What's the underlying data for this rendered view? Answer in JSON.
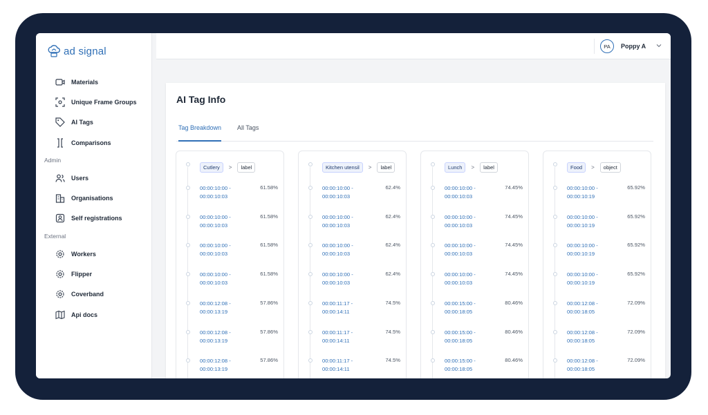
{
  "brand": {
    "name": "ad signal",
    "color": "#2f6fb6"
  },
  "sidebar": {
    "main_items": [
      {
        "label": "Materials",
        "icon": "video-icon"
      },
      {
        "label": "Unique Frame Groups",
        "icon": "frame-icon"
      },
      {
        "label": "AI Tags",
        "icon": "tag-icon"
      },
      {
        "label": "Comparisons",
        "icon": "compare-icon"
      }
    ],
    "admin_label": "Admin",
    "admin_items": [
      {
        "label": "Users",
        "icon": "users-icon"
      },
      {
        "label": "Organisations",
        "icon": "building-icon"
      },
      {
        "label": "Self registrations",
        "icon": "user-badge-icon"
      }
    ],
    "external_label": "External",
    "external_items": [
      {
        "label": "Workers",
        "icon": "gear-icon"
      },
      {
        "label": "Flipper",
        "icon": "gear-icon"
      },
      {
        "label": "Coverband",
        "icon": "gear-icon"
      },
      {
        "label": "Api docs",
        "icon": "map-icon"
      }
    ]
  },
  "topbar": {
    "avatar_initials": "PA",
    "user_name": "Poppy A"
  },
  "page": {
    "title": "AI Tag Info",
    "tabs": [
      {
        "label": "Tag Breakdown",
        "active": true
      },
      {
        "label": "All Tags",
        "active": false
      }
    ]
  },
  "columns": [
    {
      "tag": "Cutlery",
      "type": "label",
      "entries": [
        {
          "start": "00:00:10:00 -",
          "end": "00:00:10:03",
          "pct": "61.58%"
        },
        {
          "start": "00:00:10:00 -",
          "end": "00:00:10:03",
          "pct": "61.58%"
        },
        {
          "start": "00:00:10:00 -",
          "end": "00:00:10:03",
          "pct": "61.58%"
        },
        {
          "start": "00:00:10:00 -",
          "end": "00:00:10:03",
          "pct": "61.58%"
        },
        {
          "start": "00:00:12:08 -",
          "end": "00:00:13:19",
          "pct": "57.86%"
        },
        {
          "start": "00:00:12:08 -",
          "end": "00:00:13:19",
          "pct": "57.86%"
        },
        {
          "start": "00:00:12:08 -",
          "end": "00:00:13:19",
          "pct": "57.86%"
        }
      ]
    },
    {
      "tag": "Kitchen utensil",
      "type": "label",
      "entries": [
        {
          "start": "00:00:10:00 -",
          "end": "00:00:10:03",
          "pct": "62.4%"
        },
        {
          "start": "00:00:10:00 -",
          "end": "00:00:10:03",
          "pct": "62.4%"
        },
        {
          "start": "00:00:10:00 -",
          "end": "00:00:10:03",
          "pct": "62.4%"
        },
        {
          "start": "00:00:10:00 -",
          "end": "00:00:10:03",
          "pct": "62.4%"
        },
        {
          "start": "00:00:11:17 -",
          "end": "00:00:14:11",
          "pct": "74.5%"
        },
        {
          "start": "00:00:11:17 -",
          "end": "00:00:14:11",
          "pct": "74.5%"
        },
        {
          "start": "00:00:11:17 -",
          "end": "00:00:14:11",
          "pct": "74.5%"
        }
      ]
    },
    {
      "tag": "Lunch",
      "type": "label",
      "entries": [
        {
          "start": "00:00:10:00 -",
          "end": "00:00:10:03",
          "pct": "74.45%"
        },
        {
          "start": "00:00:10:00 -",
          "end": "00:00:10:03",
          "pct": "74.45%"
        },
        {
          "start": "00:00:10:00 -",
          "end": "00:00:10:03",
          "pct": "74.45%"
        },
        {
          "start": "00:00:10:00 -",
          "end": "00:00:10:03",
          "pct": "74.45%"
        },
        {
          "start": "00:00:15:00 -",
          "end": "00:00:18:05",
          "pct": "80.46%"
        },
        {
          "start": "00:00:15:00 -",
          "end": "00:00:18:05",
          "pct": "80.46%"
        },
        {
          "start": "00:00:15:00 -",
          "end": "00:00:18:05",
          "pct": "80.46%"
        }
      ]
    },
    {
      "tag": "Food",
      "type": "object",
      "entries": [
        {
          "start": "00:00:10:00 -",
          "end": "00:00:10:19",
          "pct": "65.92%"
        },
        {
          "start": "00:00:10:00 -",
          "end": "00:00:10:19",
          "pct": "65.92%"
        },
        {
          "start": "00:00:10:00 -",
          "end": "00:00:10:19",
          "pct": "65.92%"
        },
        {
          "start": "00:00:10:00 -",
          "end": "00:00:10:19",
          "pct": "65.92%"
        },
        {
          "start": "00:00:12:08 -",
          "end": "00:00:18:05",
          "pct": "72.09%"
        },
        {
          "start": "00:00:12:08 -",
          "end": "00:00:18:05",
          "pct": "72.09%"
        },
        {
          "start": "00:00:12:08 -",
          "end": "00:00:18:05",
          "pct": "72.09%"
        }
      ]
    }
  ]
}
